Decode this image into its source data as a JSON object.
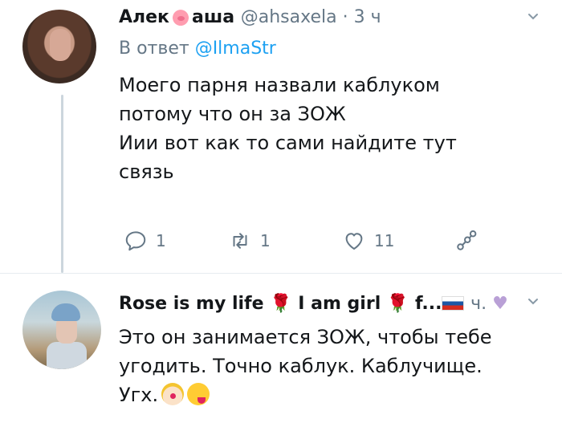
{
  "tweet1": {
    "name_part1": "Алек",
    "name_part2": "аша",
    "handle": "@ahsaxela",
    "separator": "·",
    "time": "3 ч",
    "reply_prefix": "В ответ",
    "reply_mention": "@IlmaStr",
    "text_lines": [
      "Моего парня назвали каблуком",
      "потому что он за ЗОЖ",
      "Иии вот как то сами найдите тут",
      "связь"
    ],
    "actions": {
      "reply_count": "1",
      "retweet_count": "1",
      "like_count": "11"
    },
    "icons": [
      "pig-face-emoji",
      "reply-icon",
      "retweet-icon",
      "heart-icon",
      "share-icon",
      "chevron-down-icon"
    ]
  },
  "tweet2": {
    "name_a": "Rose is my life",
    "name_b": "I am girl",
    "name_c": "f...",
    "name_tail": "ч.",
    "text_lines": [
      "Это он занимается ЗОЖ, чтобы тебе",
      "угодить. Точно каблук. Каблучище.",
      "Угх."
    ],
    "icons": [
      "rose-emoji",
      "russian-flag-emoji",
      "purple-heart-emoji",
      "clown-emoji",
      "crazy-face-emoji",
      "chevron-down-icon"
    ]
  },
  "colors": {
    "text": "#14171a",
    "secondary": "#657786",
    "link": "#1da1f2",
    "thread_line": "#ccd6dd",
    "divider": "#e6ecf0"
  }
}
